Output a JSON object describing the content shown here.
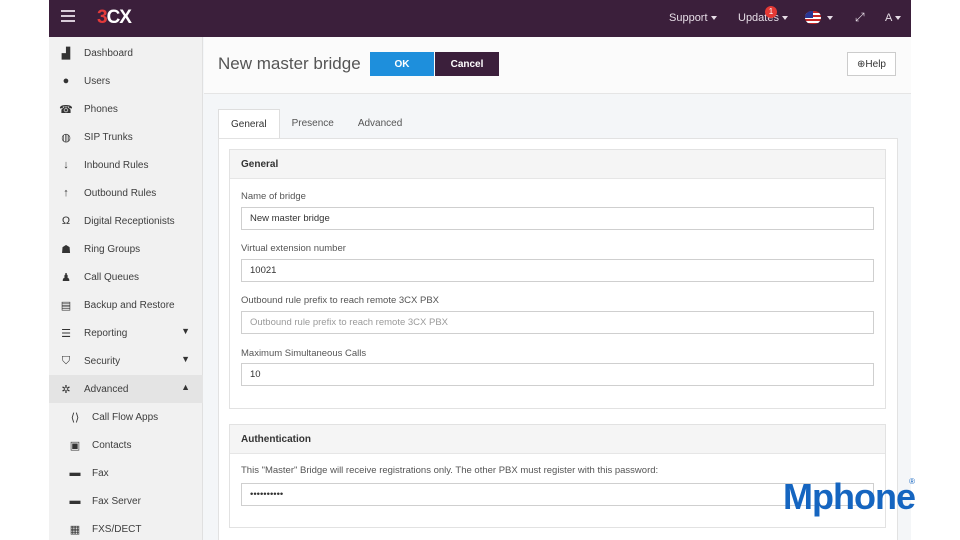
{
  "topbar": {
    "logo_three": "3",
    "logo_cx": "CX",
    "support": "Support",
    "updates": "Updates",
    "updates_badge": "1",
    "user": "A"
  },
  "sidebar": {
    "items": [
      {
        "label": "Dashboard",
        "icon": "bar-chart-icon"
      },
      {
        "label": "Users",
        "icon": "user-icon"
      },
      {
        "label": "Phones",
        "icon": "phone-icon"
      },
      {
        "label": "SIP Trunks",
        "icon": "globe-icon"
      },
      {
        "label": "Inbound Rules",
        "icon": "arrow-down-icon"
      },
      {
        "label": "Outbound Rules",
        "icon": "arrow-up-icon"
      },
      {
        "label": "Digital Receptionists",
        "icon": "headset-icon"
      },
      {
        "label": "Ring Groups",
        "icon": "group-icon"
      },
      {
        "label": "Call Queues",
        "icon": "users-icon"
      },
      {
        "label": "Backup and Restore",
        "icon": "database-icon"
      },
      {
        "label": "Reporting",
        "icon": "list-icon"
      },
      {
        "label": "Security",
        "icon": "shield-icon"
      },
      {
        "label": "Advanced",
        "icon": "gear-icon"
      },
      {
        "label": "Call Flow Apps",
        "icon": "code-icon"
      },
      {
        "label": "Contacts",
        "icon": "contact-card-icon"
      },
      {
        "label": "Fax",
        "icon": "fax-icon"
      },
      {
        "label": "Fax Server",
        "icon": "fax-icon"
      },
      {
        "label": "FXS/DECT",
        "icon": "fxs-icon"
      }
    ]
  },
  "header": {
    "title": "New master bridge",
    "ok": "OK",
    "cancel": "Cancel",
    "help": "Help"
  },
  "tabs": [
    "General",
    "Presence",
    "Advanced"
  ],
  "general": {
    "heading": "General",
    "name_label": "Name of bridge",
    "name_value": "New master bridge",
    "ext_label": "Virtual extension number",
    "ext_value": "10021",
    "prefix_label": "Outbound rule prefix to reach remote 3CX PBX",
    "prefix_placeholder": "Outbound rule prefix to reach remote 3CX PBX",
    "max_label": "Maximum Simultaneous Calls",
    "max_value": "10"
  },
  "auth": {
    "heading": "Authentication",
    "text": "This \"Master\" Bridge will receive registrations only. The other PBX must register with this password:",
    "password": "••••••••••"
  },
  "watermark": {
    "word": "Mphone",
    "reg": "®"
  },
  "colors": {
    "topbar": "#3b1f3b",
    "ok_button": "#1e8fdc",
    "cancel_button": "#3b1f3b",
    "watermark": "#1565c0"
  }
}
